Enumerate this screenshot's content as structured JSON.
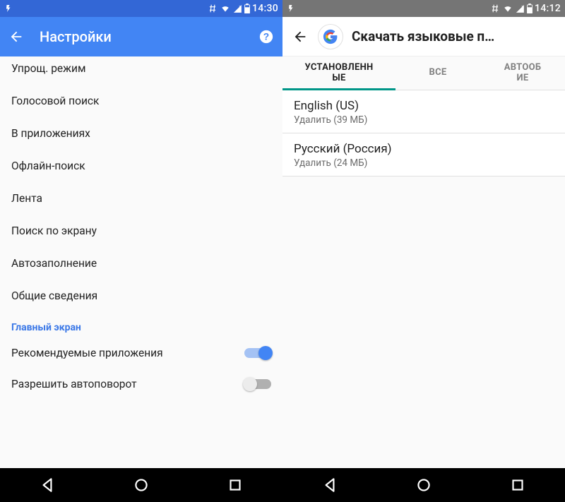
{
  "left": {
    "status": {
      "time": "14:30"
    },
    "appbar": {
      "title": "Настройки"
    },
    "items": [
      {
        "label": "Упрощ. режим"
      },
      {
        "label": "Голосовой поиск"
      },
      {
        "label": "В приложениях"
      },
      {
        "label": "Офлайн-поиск"
      },
      {
        "label": "Лента"
      },
      {
        "label": "Поиск по экрану"
      },
      {
        "label": "Автозаполнение"
      },
      {
        "label": "Общие сведения"
      }
    ],
    "section_header": "Главный экран",
    "rows": [
      {
        "label": "Рекомендуемые приложения",
        "on": true
      },
      {
        "label": "Разрешить автоповорот",
        "on": false
      }
    ]
  },
  "right": {
    "status": {
      "time": "14:12"
    },
    "toolbar": {
      "title": "Скачать языковые п…"
    },
    "tabs": [
      {
        "label": "УСТАНОВЛЕНН\nЫЕ",
        "active": true
      },
      {
        "label": "ВСЕ"
      },
      {
        "label": "АВТООБ\nИЕ"
      }
    ],
    "languages": [
      {
        "name": "English (US)",
        "sub": "Удалить (39 МБ)"
      },
      {
        "name": "Русский (Россия)",
        "sub": "Удалить (24 МБ)"
      }
    ]
  }
}
